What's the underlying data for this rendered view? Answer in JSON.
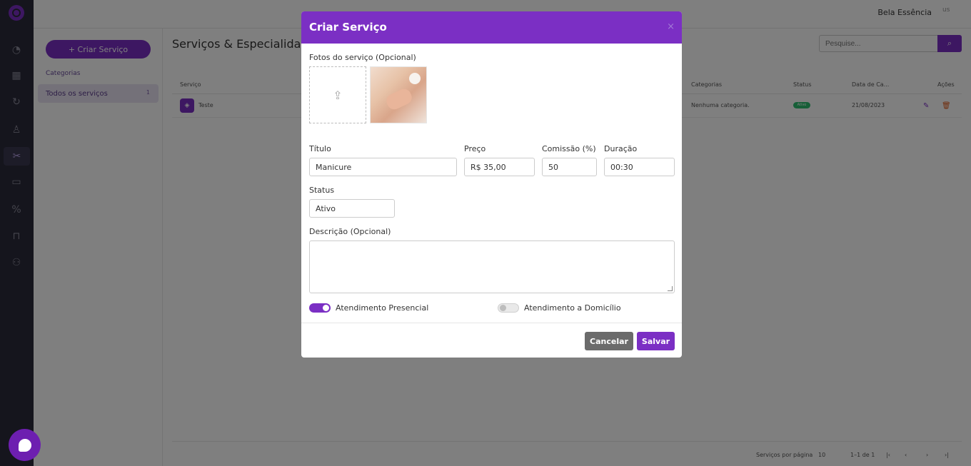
{
  "header": {
    "account_name": "Bela Essência",
    "avatar_alt": "us"
  },
  "sidebar": {
    "icons": [
      "dashboard-icon",
      "calendar-icon",
      "refresh-icon",
      "user-icon",
      "scissors-icon",
      "archive-icon",
      "percent-icon",
      "inbox-icon",
      "users-icon"
    ],
    "active": "scissors-icon"
  },
  "left_panel": {
    "create_label": "+ Criar Serviço",
    "categories_title": "Categorias",
    "category_items": [
      {
        "label": "Todos os serviços",
        "count": "1"
      }
    ]
  },
  "main": {
    "title": "Serviços & Especialidades",
    "search_placeholder": "Pesquise...",
    "table": {
      "columns": [
        "Serviço",
        "Categorias",
        "Status",
        "Data de Ca...",
        "Ações"
      ],
      "rows": [
        {
          "name": "Teste",
          "category": "Nenhuma categoria.",
          "status": "Ativo",
          "date": "21/08/2023"
        }
      ]
    },
    "footer": {
      "per_page_label": "Serviços por página",
      "per_page_value": "10",
      "range": "1–1 de 1"
    }
  },
  "modal": {
    "title": "Criar Serviço",
    "close": "×",
    "photos_label": "Fotos do serviço (Opcional)",
    "fields": {
      "title": {
        "label": "Título",
        "value": "Manicure"
      },
      "price": {
        "label": "Preço",
        "value": "R$ 35,00"
      },
      "commission": {
        "label": "Comissão (%)",
        "value": "50"
      },
      "duration": {
        "label": "Duração",
        "value": "00:30"
      },
      "status": {
        "label": "Status",
        "value": "Ativo"
      },
      "description": {
        "label": "Descrição (Opcional)",
        "value": ""
      }
    },
    "toggles": [
      {
        "label": "Atendimento Presencial",
        "on": true
      },
      {
        "label": "Atendimento a Domicílio",
        "on": false
      }
    ],
    "buttons": {
      "cancel": "Cancelar",
      "save": "Salvar"
    }
  },
  "colors": {
    "brand": "#7b2fc4",
    "sidebar": "#2b2a3a",
    "status_active": "#2fbf71",
    "delete": "#e05a1a"
  }
}
